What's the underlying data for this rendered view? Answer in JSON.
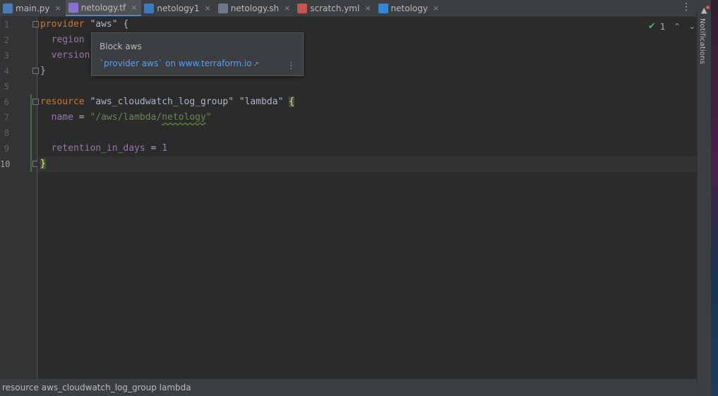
{
  "tabs": [
    {
      "label": "main.py",
      "icon": "python-file-icon",
      "color": "#4a7bb6",
      "active": false
    },
    {
      "label": "netology.tf",
      "icon": "terraform-file-icon",
      "color": "#8b6fd1",
      "active": true
    },
    {
      "label": "netology1",
      "icon": "markdown-file-icon",
      "color": "#3b79c0",
      "active": false
    },
    {
      "label": "netology.sh",
      "icon": "shell-script-icon",
      "color": "#6a7a8a",
      "active": false
    },
    {
      "label": "scratch.yml",
      "icon": "yaml-file-icon",
      "color": "#c75450",
      "active": false
    },
    {
      "label": "netology",
      "icon": "docker-file-icon",
      "color": "#2f88d8",
      "active": false
    }
  ],
  "tab_close_glyph": "×",
  "tab_menu_glyph": "⋮",
  "notifications_label": "Notifications",
  "gutter": {
    "line_numbers": [
      "1",
      "2",
      "3",
      "4",
      "5",
      "6",
      "7",
      "8",
      "9",
      "10"
    ],
    "current_line": "10"
  },
  "code": {
    "l1": {
      "kw": "provider",
      "str": "\"aws\"",
      "brace": "{"
    },
    "l2": {
      "prop": "region"
    },
    "l3": {
      "prop": "version"
    },
    "l4": {
      "brace": "}"
    },
    "l6": {
      "kw": "resource",
      "str1": "\"aws_cloudwatch_log_group\"",
      "str2": "\"lambda\"",
      "brace": "{"
    },
    "l7": {
      "prop": "name",
      "op": "=",
      "str_pre": "\"/aws/lambda/",
      "str_typo": "netology",
      "str_post": "\""
    },
    "l9": {
      "prop": "retention_in_days",
      "op": "=",
      "num": "1"
    },
    "l10": {
      "brace": "}"
    }
  },
  "inspection": {
    "check_glyph": "✔",
    "count": "1",
    "up_glyph": "⌃",
    "down_glyph": "⌄"
  },
  "popup": {
    "title": "Block aws",
    "link": "`provider aws` on www.terraform.io",
    "link_ext_glyph": "↗",
    "more_glyph": "⋮"
  },
  "status": {
    "breadcrumb": "resource aws_cloudwatch_log_group lambda"
  },
  "colors": {
    "background": "#2b2b2b",
    "keyword": "#cc7832",
    "string": "#6a8759",
    "property": "#9876aa",
    "number": "#6897bb",
    "link": "#589df6"
  }
}
